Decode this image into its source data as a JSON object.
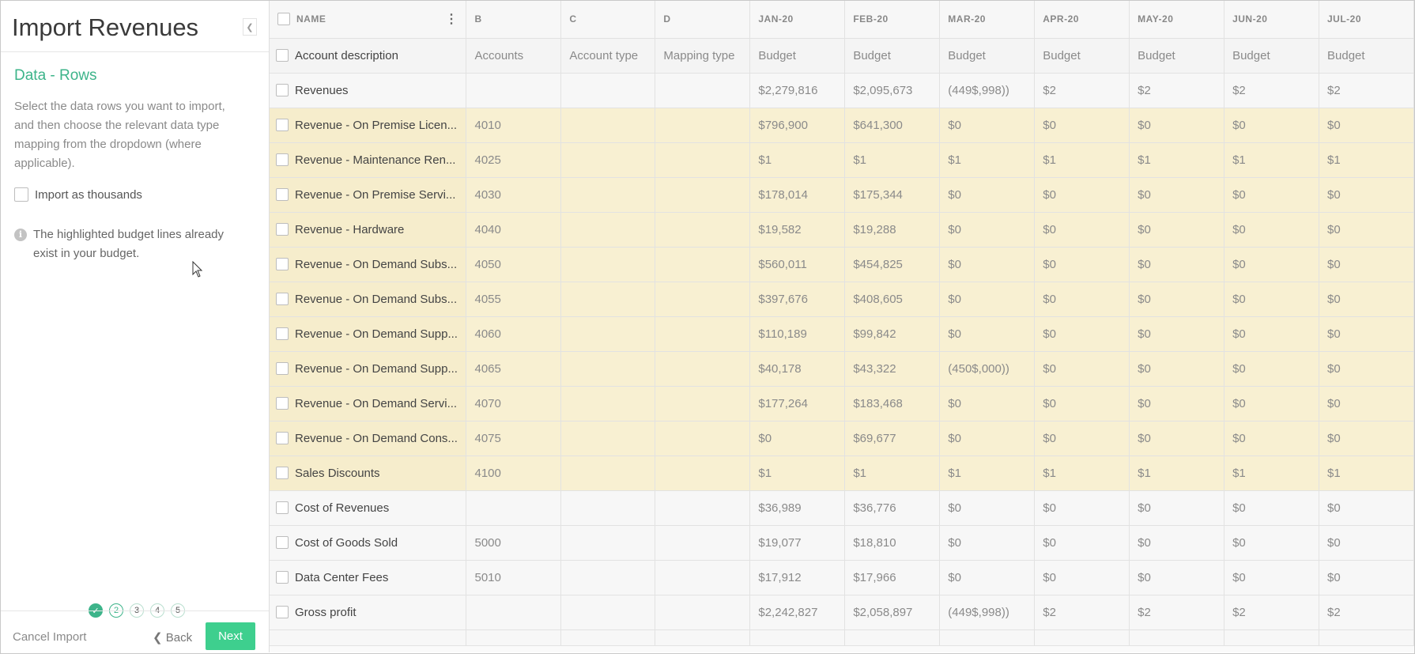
{
  "panel": {
    "title": "Import Revenues",
    "section_title": "Data - Rows",
    "instructions": "Select the data rows you want to import, and then choose the relevant data type mapping from the dropdown (where applicable).",
    "thousands_label": "Import as thousands",
    "info_text": "The highlighted budget lines already exist in your budget.",
    "steps": [
      "✓",
      "2",
      "3",
      "4",
      "5"
    ],
    "cancel_label": "Cancel Import",
    "back_label": "Back",
    "next_label": "Next"
  },
  "grid": {
    "headers": [
      "NAME",
      "B",
      "C",
      "D",
      "JAN-20",
      "FEB-20",
      "MAR-20",
      "APR-20",
      "MAY-20",
      "JUN-20",
      "JUL-20"
    ],
    "subheader": [
      "Account description",
      "Accounts",
      "Account type",
      "Mapping type",
      "Budget",
      "Budget",
      "Budget",
      "Budget",
      "Budget",
      "Budget",
      "Budget"
    ],
    "rows": [
      {
        "highlight": false,
        "cells": [
          "Revenues",
          "",
          "",
          "",
          "$2,279,816",
          "$2,095,673",
          "(449$,998))",
          "$2",
          "$2",
          "$2",
          "$2"
        ]
      },
      {
        "highlight": true,
        "cells": [
          "Revenue - On Premise Licen...",
          "4010",
          "",
          "",
          "$796,900",
          "$641,300",
          "$0",
          "$0",
          "$0",
          "$0",
          "$0"
        ]
      },
      {
        "highlight": true,
        "cells": [
          "Revenue - Maintenance Ren...",
          "4025",
          "",
          "",
          "$1",
          "$1",
          "$1",
          "$1",
          "$1",
          "$1",
          "$1"
        ]
      },
      {
        "highlight": true,
        "cells": [
          "Revenue - On Premise Servi...",
          "4030",
          "",
          "",
          "$178,014",
          "$175,344",
          "$0",
          "$0",
          "$0",
          "$0",
          "$0"
        ]
      },
      {
        "highlight": true,
        "cells": [
          "Revenue - Hardware",
          "4040",
          "",
          "",
          "$19,582",
          "$19,288",
          "$0",
          "$0",
          "$0",
          "$0",
          "$0"
        ]
      },
      {
        "highlight": true,
        "cells": [
          "Revenue - On Demand Subs...",
          "4050",
          "",
          "",
          "$560,011",
          "$454,825",
          "$0",
          "$0",
          "$0",
          "$0",
          "$0"
        ]
      },
      {
        "highlight": true,
        "cells": [
          "Revenue - On Demand Subs...",
          "4055",
          "",
          "",
          "$397,676",
          "$408,605",
          "$0",
          "$0",
          "$0",
          "$0",
          "$0"
        ]
      },
      {
        "highlight": true,
        "cells": [
          "Revenue - On Demand Supp...",
          "4060",
          "",
          "",
          "$110,189",
          "$99,842",
          "$0",
          "$0",
          "$0",
          "$0",
          "$0"
        ]
      },
      {
        "highlight": true,
        "cells": [
          "Revenue - On Demand Supp...",
          "4065",
          "",
          "",
          "$40,178",
          "$43,322",
          "(450$,000))",
          "$0",
          "$0",
          "$0",
          "$0"
        ]
      },
      {
        "highlight": true,
        "cells": [
          "Revenue - On Demand Servi...",
          "4070",
          "",
          "",
          "$177,264",
          "$183,468",
          "$0",
          "$0",
          "$0",
          "$0",
          "$0"
        ]
      },
      {
        "highlight": true,
        "cells": [
          "Revenue - On Demand Cons...",
          "4075",
          "",
          "",
          "$0",
          "$69,677",
          "$0",
          "$0",
          "$0",
          "$0",
          "$0"
        ]
      },
      {
        "highlight": true,
        "cells": [
          "Sales Discounts",
          "4100",
          "",
          "",
          "$1",
          "$1",
          "$1",
          "$1",
          "$1",
          "$1",
          "$1"
        ]
      },
      {
        "highlight": false,
        "cells": [
          "Cost of Revenues",
          "",
          "",
          "",
          "$36,989",
          "$36,776",
          "$0",
          "$0",
          "$0",
          "$0",
          "$0"
        ]
      },
      {
        "highlight": false,
        "cells": [
          "Cost of Goods Sold",
          "5000",
          "",
          "",
          "$19,077",
          "$18,810",
          "$0",
          "$0",
          "$0",
          "$0",
          "$0"
        ]
      },
      {
        "highlight": false,
        "cells": [
          "Data Center Fees",
          "5010",
          "",
          "",
          "$17,912",
          "$17,966",
          "$0",
          "$0",
          "$0",
          "$0",
          "$0"
        ]
      },
      {
        "highlight": false,
        "cells": [
          "Gross profit",
          "",
          "",
          "",
          "$2,242,827",
          "$2,058,897",
          "(449$,998))",
          "$2",
          "$2",
          "$2",
          "$2"
        ]
      }
    ]
  },
  "colors": {
    "accent": "#3db48a",
    "next_button": "#3ecf8e",
    "highlight_row": "#f8f0d2"
  },
  "icons": {
    "collapse": "chevron-left-icon",
    "info": "info-icon",
    "back": "chevron-left-icon",
    "menu": "vertical-dots-icon",
    "cursor": "mouse-pointer-icon"
  }
}
